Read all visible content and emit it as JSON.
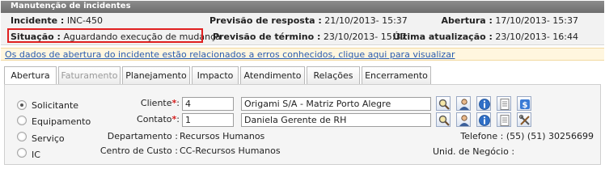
{
  "window": {
    "title": "Manutenção de incidentes"
  },
  "summary": {
    "incidente_label": "Incidente :",
    "incidente_value": "INC-450",
    "situacao_label": "Situação :",
    "situacao_value": "Aguardando execução de mudança",
    "previsao_resposta_label": "Previsão de resposta :",
    "previsao_resposta_value": "21/10/2013- 15:37",
    "previsao_termino_label": "Previsão de término :",
    "previsao_termino_value": "23/10/2013- 15:37",
    "abertura_label": "Abertura :",
    "abertura_value": "17/10/2013- 15:37",
    "ultima_atualizacao_label": "Última atualização :",
    "ultima_atualizacao_value": "23/10/2013- 16:44"
  },
  "alert": {
    "link_text": "Os dados de abertura do incidente estão relacionados a erros conhecidos, clique aqui para visualizar"
  },
  "tabs": [
    {
      "label": "Abertura",
      "state": "active"
    },
    {
      "label": "Faturamento",
      "state": "disabled"
    },
    {
      "label": "Planejamento",
      "state": "normal"
    },
    {
      "label": "Impacto",
      "state": "normal"
    },
    {
      "label": "Atendimento",
      "state": "normal"
    },
    {
      "label": "Relações",
      "state": "normal"
    },
    {
      "label": "Encerramento",
      "state": "normal"
    }
  ],
  "form": {
    "radio_options": [
      {
        "label": "Solicitante",
        "selected": true
      },
      {
        "label": "Equipamento",
        "selected": false
      },
      {
        "label": "Serviço",
        "selected": false
      },
      {
        "label": "IC",
        "selected": false
      }
    ],
    "cliente_label": "Cliente",
    "cliente_id": "4",
    "cliente_name": "Origami S/A - Matriz Porto Alegre",
    "contato_label": "Contato",
    "contato_id": "1",
    "contato_name": "Daniela Gerente de RH",
    "required_mark": "*",
    "label_suffix": ":",
    "departamento_label": "Departamento :",
    "departamento_value": "Recursos Humanos",
    "centro_custo_label": "Centro de Custo :",
    "centro_custo_value": "CC-Recursos Humanos",
    "telefone_label": "Telefone :",
    "telefone_value": "(55) (51) 30256699",
    "unid_negocio_label": "Unid. de Negócio :",
    "unid_negocio_value": ""
  },
  "icons": {
    "cliente_row": [
      "search-icon",
      "user-icon",
      "info-icon",
      "document-icon",
      "currency-icon"
    ],
    "contato_row": [
      "search-icon",
      "user-icon",
      "info-icon",
      "document-icon",
      "tools-icon"
    ]
  },
  "colors": {
    "highlight_border": "#e02020",
    "alert_background": "#fff6df",
    "link": "#2a5db0",
    "required": "#d62020"
  }
}
